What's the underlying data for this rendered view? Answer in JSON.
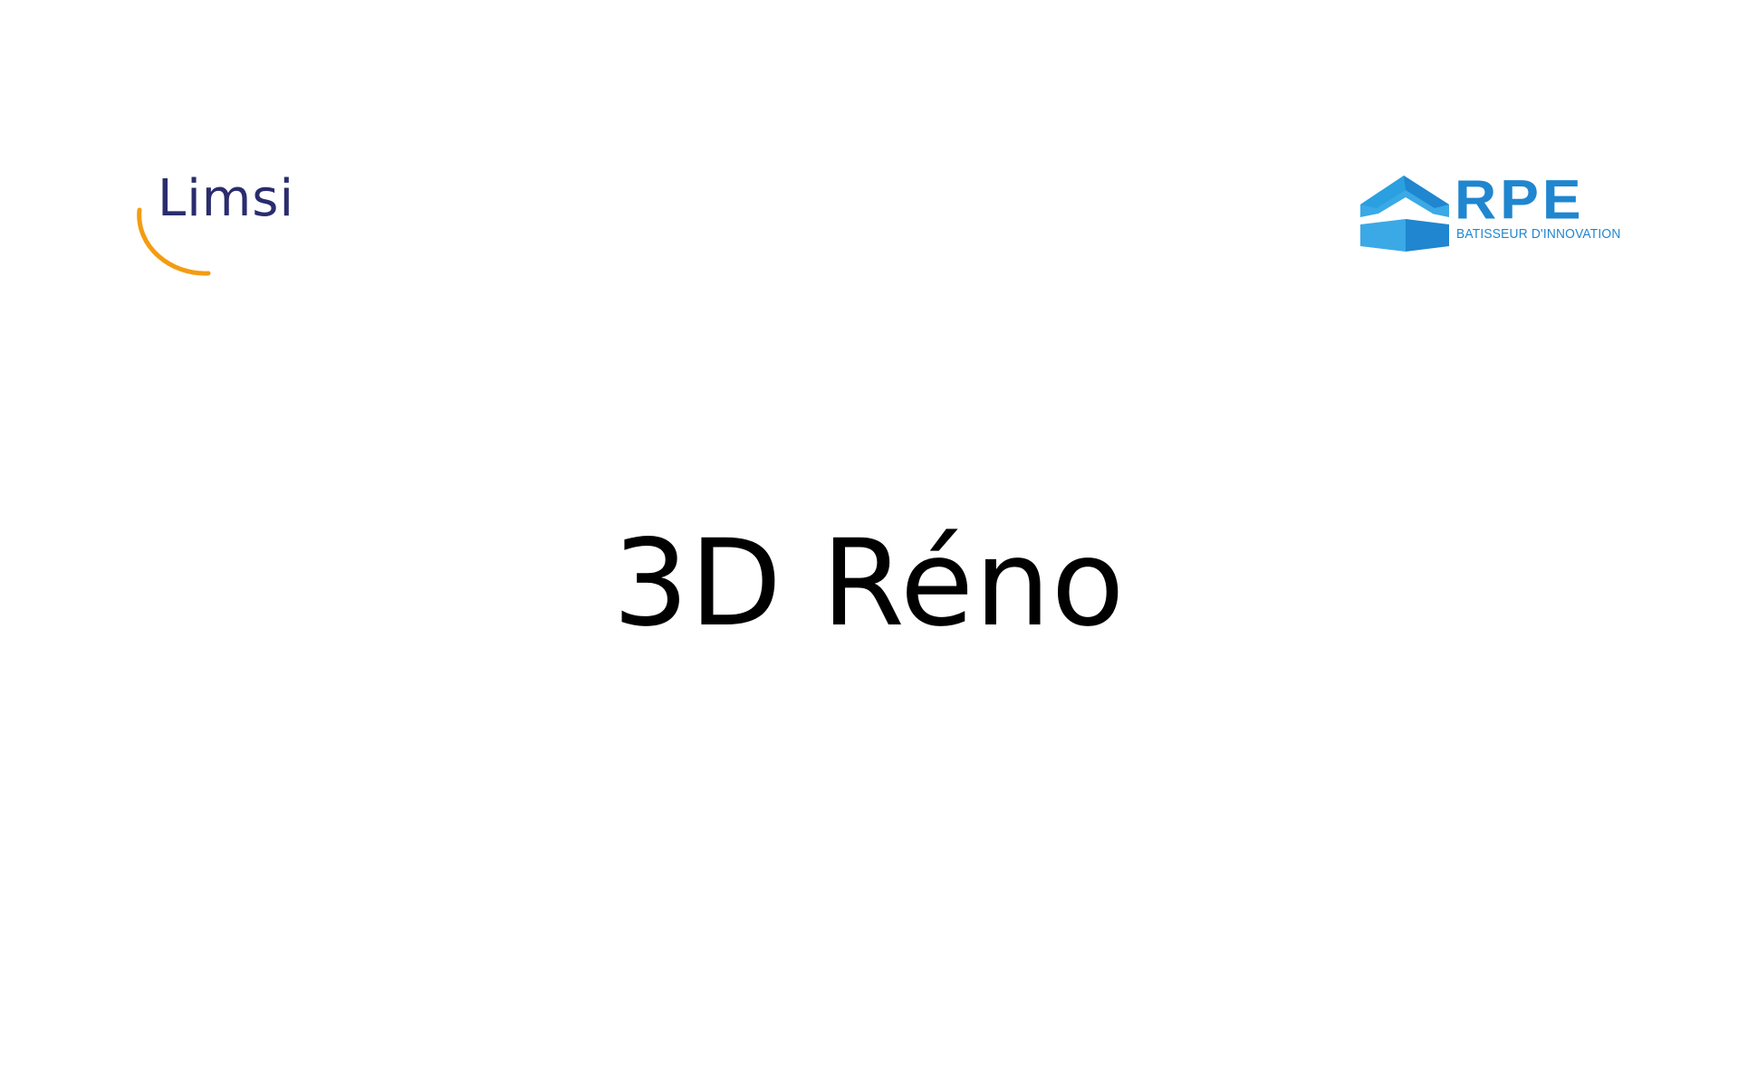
{
  "logos": {
    "left": {
      "wordmark": "Limsi",
      "colors": {
        "text": "#2a2c6e",
        "arc": "#f39c12"
      }
    },
    "right": {
      "wordmark": "RPE",
      "tagline": "BATISSEUR D'INNOVATION",
      "colors": {
        "primary": "#1f86cf",
        "secondary": "#3aa9e6"
      }
    }
  },
  "slide": {
    "title": "3D Réno"
  }
}
